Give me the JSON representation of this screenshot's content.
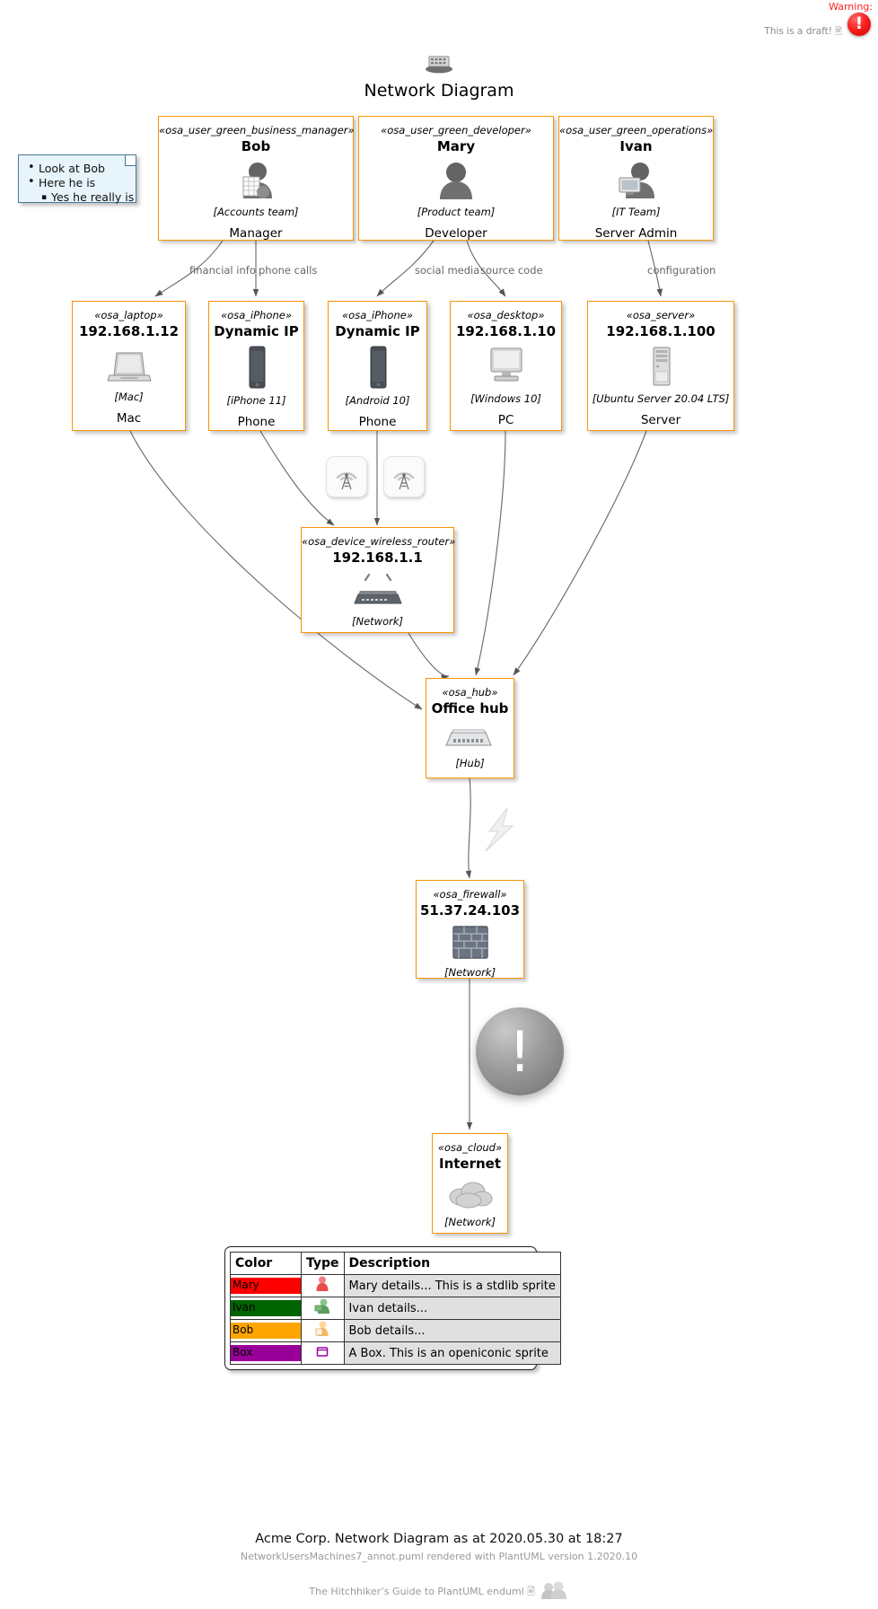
{
  "header": {
    "warning_label": "Warning:",
    "warning_icon": "exclamation-circle-red",
    "draft_text": "This is a draft!",
    "draft_icon": "note-glyph"
  },
  "title": {
    "text": "Network Diagram",
    "icon": "office-building-sprite"
  },
  "note": {
    "items": [
      "Look at Bob",
      "Here he is"
    ],
    "sub_item": "Yes he really is"
  },
  "nodes": {
    "bob": {
      "stereotype": "«osa_user_green_business_manager»",
      "name": "Bob",
      "desc": "[Accounts team]",
      "role": "Manager",
      "icon": "user-with-spreadsheet-sprite"
    },
    "mary": {
      "stereotype": "«osa_user_green_developer»",
      "name": "Mary",
      "desc": "[Product team]",
      "role": "Developer",
      "icon": "user-sprite"
    },
    "ivan": {
      "stereotype": "«osa_user_green_operations»",
      "name": "Ivan",
      "desc": "[IT Team]",
      "role": "Server Admin",
      "icon": "user-with-monitor-sprite"
    },
    "laptop": {
      "stereotype": "«osa_laptop»",
      "name": "192.168.1.12",
      "desc": "[Mac]",
      "role": "Mac",
      "icon": "laptop-sprite"
    },
    "iphone": {
      "stereotype": "«osa_iPhone»",
      "name": "Dynamic IP",
      "desc": "[iPhone 11]",
      "role": "Phone",
      "icon": "iphone-sprite"
    },
    "android": {
      "stereotype": "«osa_iPhone»",
      "name": "Dynamic IP",
      "desc": "[Android 10]",
      "role": "Phone",
      "icon": "android-phone-sprite"
    },
    "desktop": {
      "stereotype": "«osa_desktop»",
      "name": "192.168.1.10",
      "desc": "[Windows 10]",
      "role": "PC",
      "icon": "desktop-pc-sprite"
    },
    "server": {
      "stereotype": "«osa_server»",
      "name": "192.168.1.100",
      "desc": "[Ubuntu Server 20.04 LTS]",
      "role": "Server",
      "icon": "server-tower-sprite"
    },
    "router": {
      "stereotype": "«osa_device_wireless_router»",
      "name": "192.168.1.1",
      "desc": "[Network]",
      "icon": "wireless-router-sprite"
    },
    "hub": {
      "stereotype": "«osa_hub»",
      "name": "Office hub",
      "desc": "[Hub]",
      "icon": "network-hub-sprite"
    },
    "firewall": {
      "stereotype": "«osa_firewall»",
      "name": "51.37.24.103",
      "desc": "[Network]",
      "icon": "brick-wall-sprite"
    },
    "cloud": {
      "stereotype": "«osa_cloud»",
      "name": "Internet",
      "desc": "[Network]",
      "icon": "cloud-sprite"
    }
  },
  "edge_labels": {
    "financial_info": "financial info",
    "phone_calls": "phone calls",
    "social_media": "social media",
    "source_code": "source code",
    "configuration": "configuration"
  },
  "decorations": {
    "wifi_icon_1": "wifi-tower-icon",
    "wifi_icon_2": "wifi-tower-icon",
    "lightning_icon": "lightning-bolt-sprite",
    "alert_icon": "exclamation-circle-gray"
  },
  "legend": {
    "headers": [
      "Color",
      "Type",
      "Description"
    ],
    "rows": [
      {
        "label": "Mary",
        "color": "#FF0000",
        "type_icon": "red-user-sprite",
        "description": "Mary details... This is a stdlib sprite"
      },
      {
        "label": "Ivan",
        "color": "#006400",
        "type_icon": "green-user-sprite",
        "description": "Ivan details..."
      },
      {
        "label": "Bob",
        "color": "#FFA500",
        "type_icon": "orange-user-sprite",
        "description": "Bob details..."
      },
      {
        "label": "Box",
        "color": "#990099",
        "type_icon": "purple-box-icon",
        "description": "A Box. This is an openiconic sprite"
      }
    ]
  },
  "footer": {
    "line1": "Acme Corp. Network Diagram as at 2020.05.30 at 18:27",
    "line2": "NetworkUsersMachines7_annot.puml rendered with PlantUML version 1.2020.10",
    "line3": "The Hitchhiker’s Guide to PlantUML enduml",
    "line3_icon": "note-glyph",
    "line3_sprite": "users-group-sprite"
  },
  "colors": {
    "node_border": "#F89406",
    "warning_red": "#FF2020",
    "edge_gray": "#666666",
    "note_fill": "#E8F4FB"
  }
}
